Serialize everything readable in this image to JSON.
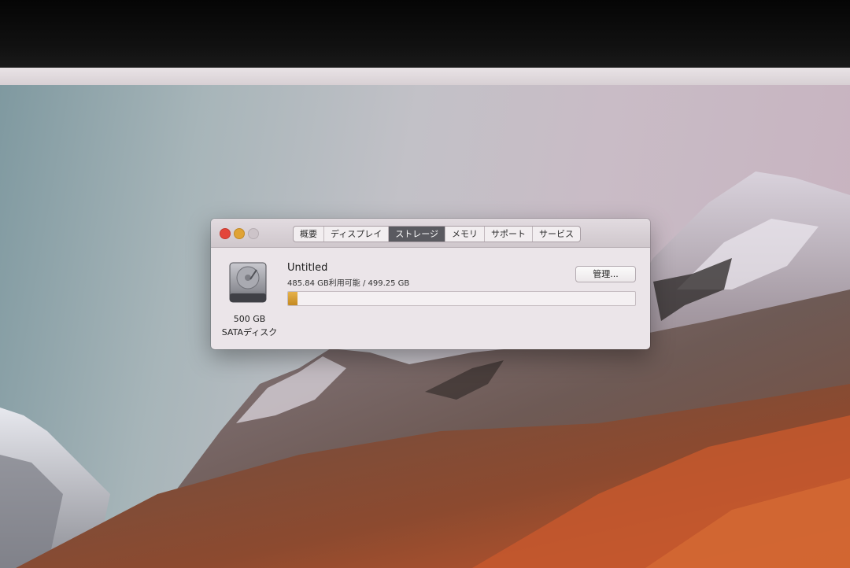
{
  "window": {
    "controls": [
      "close",
      "minimize",
      "zoom"
    ],
    "tabs": [
      {
        "label": "概要",
        "active": false
      },
      {
        "label": "ディスプレイ",
        "active": false
      },
      {
        "label": "ストレージ",
        "active": true
      },
      {
        "label": "メモリ",
        "active": false
      },
      {
        "label": "サポート",
        "active": false
      },
      {
        "label": "サービス",
        "active": false
      }
    ]
  },
  "storage": {
    "disk_icon": "hard-drive-icon",
    "disk_size": "500 GB",
    "disk_type": "SATAディスク",
    "volume_name": "Untitled",
    "usage_text": "485.84 GB利用可能 / 499.25 GB",
    "manage_label": "管理...",
    "used_fraction": 0.027,
    "bar_color": "#d89d2f"
  },
  "colors": {
    "close": "#e3453a",
    "minimize": "#e0a335",
    "zoom_disabled": "#cdc4c9",
    "active_tab": "#5a5a60"
  }
}
